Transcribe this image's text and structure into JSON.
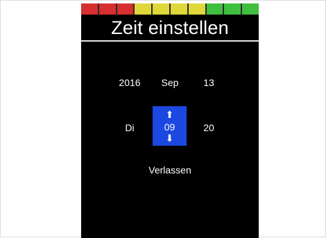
{
  "screen": {
    "title": "Zeit einstellen",
    "led_colors": [
      "#d62f2f",
      "#d62f2f",
      "#d62f2f",
      "#e0d73a",
      "#e0d73a",
      "#e0d73a",
      "#e0d73a",
      "#3fbf3f",
      "#3fbf3f",
      "#3fbf3f"
    ]
  },
  "date": {
    "year": "2016",
    "month": "Sep",
    "day": "13"
  },
  "time": {
    "weekday": "Di",
    "hour": "09",
    "minute": "20"
  },
  "exit_label": "Verlassen",
  "icons": {
    "up": "arrow-up-icon",
    "down": "arrow-down-icon"
  }
}
